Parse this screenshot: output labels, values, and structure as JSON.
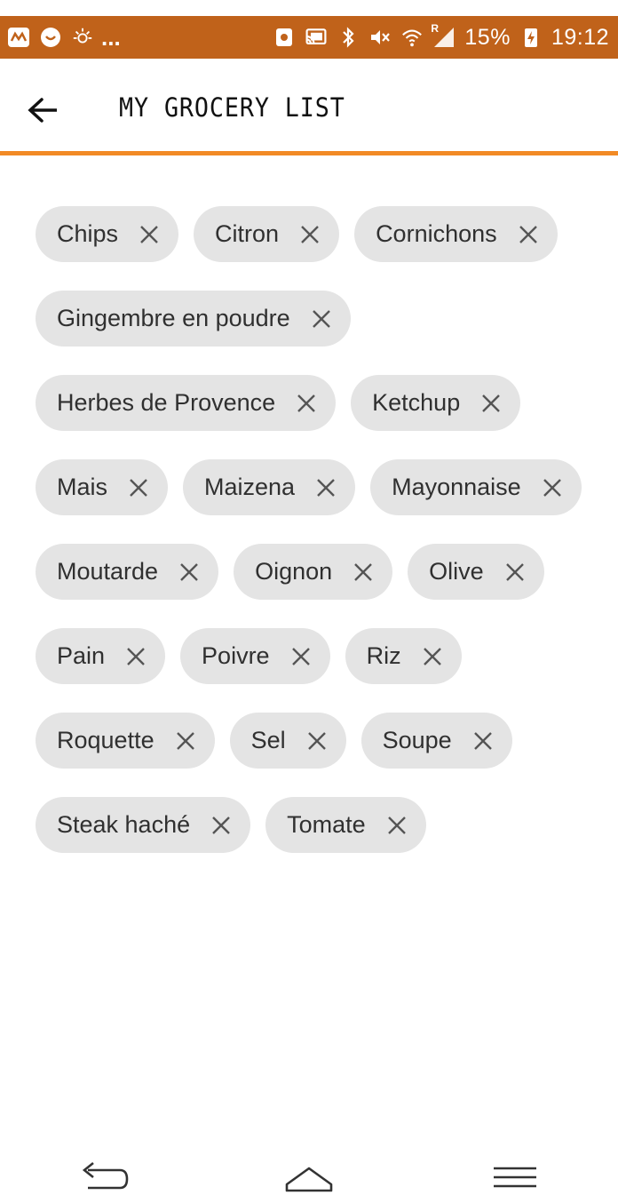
{
  "status_bar": {
    "left_dots": "...",
    "battery_percent": "15%",
    "roaming_mark": "R",
    "time": "19:12",
    "icons_left": [
      "app-notification-icon",
      "chat-notification-icon",
      "sun-icon"
    ],
    "icons_right": [
      "screenshot-icon",
      "cast-icon",
      "bluetooth-icon",
      "vibrate-mute-icon",
      "wifi-icon",
      "signal-icon",
      "battery-charging-icon"
    ],
    "bg_color": "#c0621a"
  },
  "app_bar": {
    "title": "MY GROCERY LIST",
    "back_icon": "arrow-back-icon",
    "accent_color": "#f28a25"
  },
  "grocery_items": [
    {
      "label": "Chips"
    },
    {
      "label": "Citron"
    },
    {
      "label": "Cornichons"
    },
    {
      "label": "Gingembre en poudre"
    },
    {
      "label": "Herbes de Provence"
    },
    {
      "label": "Ketchup"
    },
    {
      "label": "Mais"
    },
    {
      "label": "Maizena"
    },
    {
      "label": "Mayonnaise"
    },
    {
      "label": "Moutarde"
    },
    {
      "label": "Oignon"
    },
    {
      "label": "Olive"
    },
    {
      "label": "Pain"
    },
    {
      "label": "Poivre"
    },
    {
      "label": "Riz"
    },
    {
      "label": "Roquette"
    },
    {
      "label": "Sel"
    },
    {
      "label": "Soupe"
    },
    {
      "label": "Steak haché"
    },
    {
      "label": "Tomate"
    }
  ],
  "chip_style": {
    "bg_color": "#e4e4e4",
    "text_color": "#303030",
    "remove_icon": "close-icon"
  },
  "nav_bar": {
    "icons": [
      "back-nav-icon",
      "home-icon",
      "menu-icon"
    ]
  }
}
